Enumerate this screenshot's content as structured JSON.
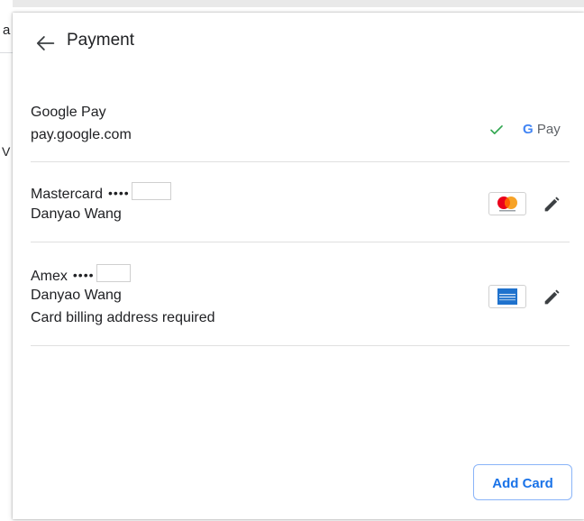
{
  "background": {
    "fragment_a": "a",
    "fragment_v": "V"
  },
  "header": {
    "back_icon": "arrow-left-icon",
    "title": "Payment"
  },
  "methods": [
    {
      "kind": "google-pay",
      "name": "Google Pay",
      "subtitle": "pay.google.com",
      "selected": true,
      "check_color": "#34a853",
      "logo_g": "G",
      "logo_pay": "Pay"
    },
    {
      "kind": "mastercard",
      "name": "Mastercard",
      "dots": "••••",
      "holder": "Danyao Wang"
    },
    {
      "kind": "amex",
      "name": "Amex",
      "dots": "••••",
      "holder": "Danyao Wang",
      "warning": "Card billing address required"
    }
  ],
  "actions": {
    "add_card_label": "Add Card"
  },
  "colors": {
    "accent": "#1a73e8",
    "divider": "#e0e0e0"
  }
}
